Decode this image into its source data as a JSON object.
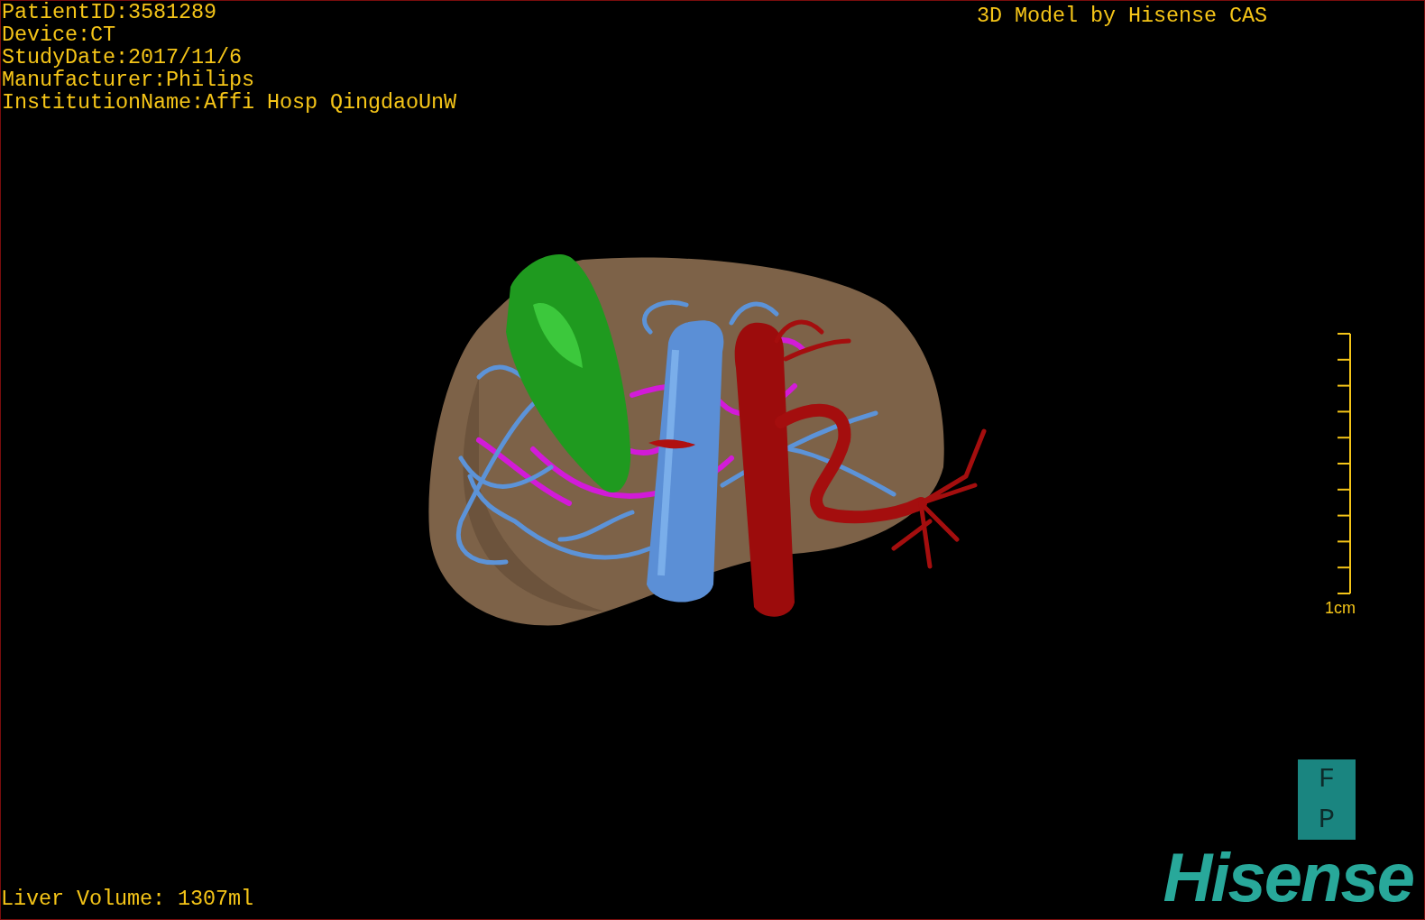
{
  "study_info": [
    "PatientID:3581289",
    "Device:CT",
    "StudyDate:2017/11/6",
    "Manufacturer:Philips",
    "InstitutionName:Affi Hosp QingdaoUnW"
  ],
  "title": "3D Model by Hisense CAS",
  "scale_bar": {
    "label": "1cm"
  },
  "orientation_cube": {
    "top": "F",
    "bottom": "P"
  },
  "logo": "Hisense",
  "liver_volume": "Liver Volume: 1307ml"
}
